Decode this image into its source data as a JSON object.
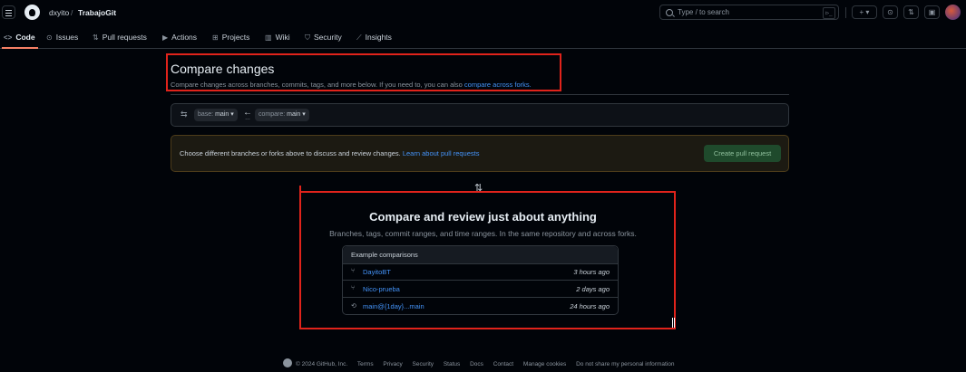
{
  "header": {
    "owner": "dxyito",
    "separator": "/",
    "repo": "TrabajoGit",
    "search_placeholder": "Type / to search",
    "command_glyph": "▷_",
    "plus_label": "+ ▾"
  },
  "tabs": [
    {
      "icon": "<>",
      "label": "Code"
    },
    {
      "icon": "⊙",
      "label": "Issues"
    },
    {
      "icon": "⇅",
      "label": "Pull requests"
    },
    {
      "icon": "▶",
      "label": "Actions"
    },
    {
      "icon": "⊞",
      "label": "Projects"
    },
    {
      "icon": "▥",
      "label": "Wiki"
    },
    {
      "icon": "⛉",
      "label": "Security"
    },
    {
      "icon": "⟋",
      "label": "Insights"
    }
  ],
  "compare": {
    "title": "Compare changes",
    "subtitle": "Compare changes across branches, commits, tags, and more below. If you need to, you can also ",
    "subtitle_link": "compare across forks.",
    "base_prefix": "base:",
    "base_branch": "main",
    "compare_prefix": "compare:",
    "compare_branch": "main"
  },
  "flash": {
    "message": "Choose different branches or forks above to discuss and review changes. ",
    "link": "Learn about pull requests",
    "button": "Create pull request"
  },
  "blankslate": {
    "heading": "Compare and review just about anything",
    "text": "Branches, tags, commit ranges, and time ranges. In the same repository and across forks.",
    "examples_header": "Example comparisons",
    "examples": [
      {
        "label": "DayitoBT",
        "time": "3 hours ago",
        "icon": "branch-icon"
      },
      {
        "label": "Nico-prueba",
        "time": "2 days ago",
        "icon": "branch-icon"
      },
      {
        "label": "main@{1day}...main",
        "time": "24 hours ago",
        "icon": "history-icon"
      }
    ]
  },
  "footer": {
    "copyright": "© 2024 GitHub, Inc.",
    "links": [
      "Terms",
      "Privacy",
      "Security",
      "Status",
      "Docs",
      "Contact",
      "Manage cookies",
      "Do not share my personal information"
    ]
  },
  "colors": {
    "background": "#010409",
    "accent_link": "#4493f8",
    "annotation_red": "#e0231b",
    "active_tab": "#f78166"
  }
}
